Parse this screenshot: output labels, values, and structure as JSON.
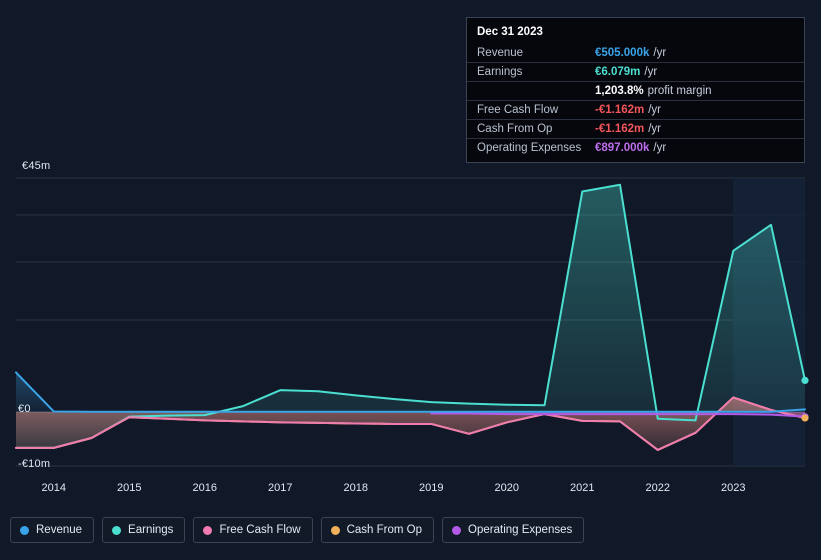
{
  "chart_data": {
    "type": "area",
    "title": "",
    "xlabel": "",
    "ylabel": "",
    "ylim": [
      -10,
      45
    ],
    "ytick_labels": [
      "€45m",
      "€0",
      "-€10m"
    ],
    "ytick_values": [
      45,
      0,
      -10
    ],
    "grid": true,
    "x_tick_labels": [
      "2014",
      "2015",
      "2016",
      "2017",
      "2018",
      "2019",
      "2020",
      "2021",
      "2022",
      "2023"
    ],
    "x": [
      2013.5,
      2014,
      2014.5,
      2015,
      2015.5,
      2016,
      2016.5,
      2017,
      2017.5,
      2018,
      2018.5,
      2019,
      2019.5,
      2020,
      2020.5,
      2021,
      2021.5,
      2022,
      2022.5,
      2023,
      2023.5,
      2023.95
    ],
    "units": "millions of EUR",
    "series": [
      {
        "name": "Revenue",
        "color": "#3aa4e8",
        "values": [
          7.6,
          0.1,
          0.05,
          0.05,
          0.05,
          0.05,
          0.05,
          0.05,
          0.05,
          0.05,
          0.05,
          0.05,
          0.05,
          0.05,
          0.05,
          0.05,
          0.05,
          0.05,
          0.05,
          0.05,
          0.05,
          0.505
        ]
      },
      {
        "name": "Earnings",
        "color": "#4adfd0",
        "values": [
          -6.9,
          -6.9,
          -5.0,
          -0.9,
          -0.7,
          -0.6,
          1.1,
          4.2,
          4.0,
          3.2,
          2.5,
          1.9,
          1.6,
          1.4,
          1.3,
          42.4,
          43.7,
          -1.3,
          -1.6,
          31.0,
          36.0,
          6.079
        ]
      },
      {
        "name": "Free Cash Flow",
        "color": "#ef7bb0",
        "values": [
          -6.9,
          -6.9,
          -5.0,
          -1.0,
          -1.3,
          -1.6,
          -1.8,
          -2.0,
          -2.1,
          -2.2,
          -2.3,
          -2.3,
          -4.2,
          -2.0,
          -0.4,
          -1.7,
          -1.8,
          -7.3,
          -4.0,
          2.8,
          0.4,
          -1.162
        ]
      },
      {
        "name": "Cash From Op",
        "color": "#f0b059",
        "values": [
          -6.9,
          -6.9,
          -5.0,
          -1.0,
          -1.3,
          -1.6,
          -1.8,
          -2.0,
          -2.1,
          -2.2,
          -2.3,
          -2.3,
          -4.2,
          -2.0,
          -0.4,
          -1.7,
          -1.8,
          -7.3,
          -4.0,
          2.8,
          0.4,
          -1.162
        ]
      },
      {
        "name": "Operating Expenses",
        "color": "#b45ae8",
        "values": [
          null,
          null,
          null,
          null,
          null,
          null,
          null,
          null,
          null,
          null,
          null,
          -0.3,
          -0.3,
          -0.4,
          -0.4,
          -0.4,
          -0.4,
          -0.4,
          -0.4,
          -0.4,
          -0.5,
          -0.897
        ]
      }
    ]
  },
  "tooltip": {
    "date": "Dec 31 2023",
    "rows": [
      {
        "label": "Revenue",
        "value": "€505.000k",
        "unit": "/yr",
        "color": "#3aa4e8",
        "sub": ""
      },
      {
        "label": "Earnings",
        "value": "€6.079m",
        "unit": "/yr",
        "color": "#4adfd0",
        "sub": ""
      },
      {
        "label": "",
        "value": "1,203.8%",
        "unit": "",
        "color": "#ffffff",
        "sub": "profit margin"
      },
      {
        "label": "Free Cash Flow",
        "value": "-€1.162m",
        "unit": "/yr",
        "color": "#f2565a",
        "sub": ""
      },
      {
        "label": "Cash From Op",
        "value": "-€1.162m",
        "unit": "/yr",
        "color": "#f2565a",
        "sub": ""
      },
      {
        "label": "Operating Expenses",
        "value": "€897.000k",
        "unit": "/yr",
        "color": "#c06ef0",
        "sub": ""
      }
    ]
  },
  "legend": {
    "items": [
      {
        "label": "Revenue",
        "color": "#3aa4e8"
      },
      {
        "label": "Earnings",
        "color": "#4adfd0"
      },
      {
        "label": "Free Cash Flow",
        "color": "#ef7bb0"
      },
      {
        "label": "Cash From Op",
        "color": "#f0b059"
      },
      {
        "label": "Operating Expenses",
        "color": "#b45ae8"
      }
    ]
  },
  "axis": {
    "y_top": "€45m",
    "y_zero": "€0",
    "y_bottom": "-€10m"
  }
}
